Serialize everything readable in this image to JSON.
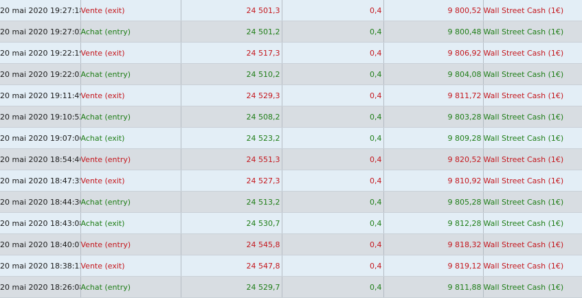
{
  "trades": [
    {
      "date": "20 mai 2020 19:27:18",
      "type": "Vente (exit)",
      "price": "24 501,3",
      "qty": "0,4",
      "amount": "9 800,52",
      "instrument": "Wall Street Cash (1€)"
    },
    {
      "date": "20 mai 2020 19:27:02",
      "type": "Achat (entry)",
      "price": "24 501,2",
      "qty": "0,4",
      "amount": "9 800,48",
      "instrument": "Wall Street Cash (1€)"
    },
    {
      "date": "20 mai 2020 19:22:19",
      "type": "Vente (exit)",
      "price": "24 517,3",
      "qty": "0,4",
      "amount": "9 806,92",
      "instrument": "Wall Street Cash (1€)"
    },
    {
      "date": "20 mai 2020 19:22:03",
      "type": "Achat (entry)",
      "price": "24 510,2",
      "qty": "0,4",
      "amount": "9 804,08",
      "instrument": "Wall Street Cash (1€)"
    },
    {
      "date": "20 mai 2020 19:11:49",
      "type": "Vente (exit)",
      "price": "24 529,3",
      "qty": "0,4",
      "amount": "9 811,72",
      "instrument": "Wall Street Cash (1€)"
    },
    {
      "date": "20 mai 2020 19:10:52",
      "type": "Achat (entry)",
      "price": "24 508,2",
      "qty": "0,4",
      "amount": "9 803,28",
      "instrument": "Wall Street Cash (1€)"
    },
    {
      "date": "20 mai 2020 19:07:06",
      "type": "Achat (exit)",
      "price": "24 523,2",
      "qty": "0,4",
      "amount": "9 809,28",
      "instrument": "Wall Street Cash (1€)"
    },
    {
      "date": "20 mai 2020 18:54:46",
      "type": "Vente (entry)",
      "price": "24 551,3",
      "qty": "0,4",
      "amount": "9 820,52",
      "instrument": "Wall Street Cash (1€)"
    },
    {
      "date": "20 mai 2020 18:47:35",
      "type": "Vente (exit)",
      "price": "24 527,3",
      "qty": "0,4",
      "amount": "9 810,92",
      "instrument": "Wall Street Cash (1€)"
    },
    {
      "date": "20 mai 2020 18:44:30",
      "type": "Achat (entry)",
      "price": "24 513,2",
      "qty": "0,4",
      "amount": "9 805,28",
      "instrument": "Wall Street Cash (1€)"
    },
    {
      "date": "20 mai 2020 18:43:08",
      "type": "Achat (exit)",
      "price": "24 530,7",
      "qty": "0,4",
      "amount": "9 812,28",
      "instrument": "Wall Street Cash (1€)"
    },
    {
      "date": "20 mai 2020 18:40:07",
      "type": "Vente (entry)",
      "price": "24 545,8",
      "qty": "0,4",
      "amount": "9 818,32",
      "instrument": "Wall Street Cash (1€)"
    },
    {
      "date": "20 mai 2020 18:38:13",
      "type": "Vente (exit)",
      "price": "24 547,8",
      "qty": "0,4",
      "amount": "9 819,12",
      "instrument": "Wall Street Cash (1€)"
    },
    {
      "date": "20 mai 2020 18:26:08",
      "type": "Achat (entry)",
      "price": "24 529,7",
      "qty": "0,4",
      "amount": "9 811,88",
      "instrument": "Wall Street Cash (1€)"
    }
  ],
  "colors": {
    "buy": "#1e7d16",
    "sell": "#c4161c",
    "row_light": "#e3eef6",
    "row_dark": "#d8dde2"
  }
}
